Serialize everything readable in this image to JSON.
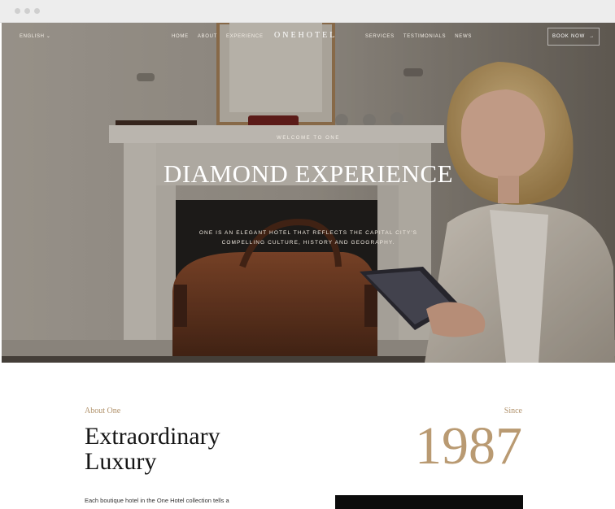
{
  "nav": {
    "language": "ENGLISH",
    "left_links": [
      "HOME",
      "ABOUT",
      "EXPERIENCE"
    ],
    "logo": "ONEHOTEL",
    "right_links": [
      "SERVICES",
      "TESTIMONIALS",
      "NEWS"
    ],
    "book_label": "BOOK NOW",
    "book_arrow": "→"
  },
  "hero": {
    "eyebrow": "WELCOME TO ONE",
    "title": "DIAMOND EXPERIENCE",
    "description": "ONE IS AN ELEGANT HOTEL THAT REFLECTS THE CAPITAL CITY'S COMPELLING CULTURE, HISTORY AND GEOGRAPHY."
  },
  "about": {
    "label": "About One",
    "title_line1": "Extraordinary",
    "title_line2": "Luxury",
    "body": "Each boutique hotel in the One Hotel collection tells a"
  },
  "since": {
    "label": "Since",
    "year": "1987"
  },
  "colors": {
    "accent": "#b0916a",
    "year": "#b99a72",
    "heading": "#161616"
  }
}
